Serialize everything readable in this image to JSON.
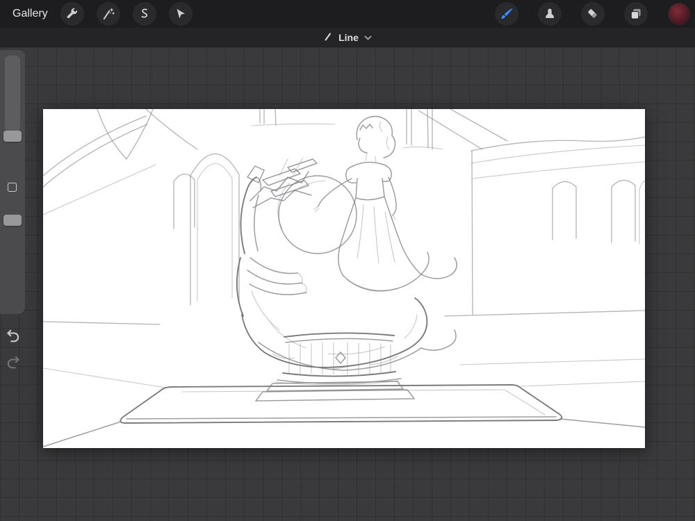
{
  "top_toolbar": {
    "gallery_label": "Gallery",
    "left_tools": [
      {
        "id": "actions",
        "icon": "wrench-icon"
      },
      {
        "id": "adjustments",
        "icon": "magic-wand-icon"
      },
      {
        "id": "selection",
        "icon": "selection-s-icon"
      },
      {
        "id": "transform",
        "icon": "transform-arrow-icon"
      }
    ],
    "right_tools": [
      {
        "id": "paint",
        "icon": "brush-icon",
        "active": true
      },
      {
        "id": "smudge",
        "icon": "smudge-finger-icon",
        "active": false
      },
      {
        "id": "erase",
        "icon": "eraser-icon",
        "active": false
      },
      {
        "id": "layers",
        "icon": "layers-icon",
        "active": false
      },
      {
        "id": "color",
        "icon": "color-swatch-icon",
        "swatch_color": "#581a26"
      }
    ],
    "active_tool_color": "#3d8bf5"
  },
  "tool_status_bar": {
    "current_tool": "Line"
  },
  "sidebar": {
    "sliders": [
      {
        "id": "brush-size"
      },
      {
        "id": "opacity"
      }
    ],
    "has_modify_button": true,
    "undo_enabled": true,
    "redo_enabled": false
  },
  "canvas": {
    "background_color": "#ffffff",
    "content_description": "Rough pencil sketch: a giant sculpted hand holding a sphere with crystal shards, a woman in a flowing gown standing beside the sphere, on a slatted round pedestal atop a low platform, inside a hall with pointed arches and a rounded apse with arched windows."
  },
  "colors": {
    "toolbar_bg": "#1d1d1f",
    "statusbar_bg": "#242427",
    "workspace_bg": "#3a3a3c",
    "sidebar_bg": "#4b4b4e",
    "accent_blue": "#3d8bf5"
  }
}
